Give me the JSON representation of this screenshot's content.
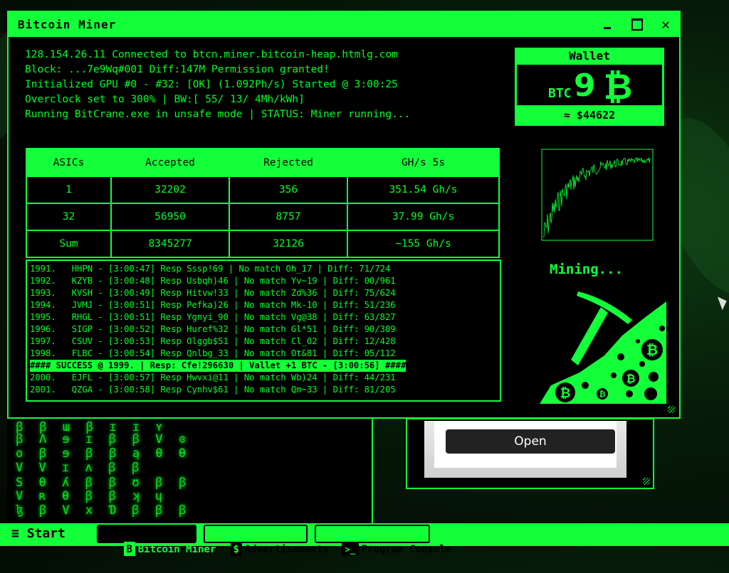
{
  "window": {
    "title": "Bitcoin Miner",
    "close_glyph": "✕"
  },
  "log": [
    "128.154.26.11 Connected to btcn.miner.bitcoin-heap.htmlg.com",
    "Block: ...7e9Wq#001 Diff:147M Permission granted!",
    "Initialized GPU #0 - #32: [OK] (1.092Ph/s) Started @ 3:00:25",
    "Overclock set to 300% | BW:[ 55/ 13/ 4Mh/kWh]",
    "Running BitCrane.exe in unsafe mode | STATUS: Miner running..."
  ],
  "wallet": {
    "title": "Wallet",
    "currency": "BTC",
    "amount": "9",
    "usd": "≈ $44622"
  },
  "stats": {
    "headers": [
      "ASICs",
      "Accepted",
      "Rejected",
      "GH/s 5s"
    ],
    "rows": [
      [
        "1",
        "32202",
        "356",
        "351.54 Gh/s"
      ],
      [
        "32",
        "56950",
        "8757",
        "37.99 Gh/s"
      ],
      [
        "Sum",
        "8345277",
        "32126",
        "~155 Gh/s"
      ]
    ]
  },
  "mining_log": [
    "1991.   HHPN - [3:00:47] Resp Sssp!69 | No match Oh_17 | Diff: 71/724",
    "1992.   KZYB - [3:00:48] Resp Usbqh)46 | No match Yv~19 | Diff: 00/961",
    "1993.   KVSH - [3:00:49] Resp Hitvw!33 | No match Zd%36 | Diff: 75/624",
    "1994.   JVMJ - [3:00:51] Resp Pefka)26 | No match Mk-10 | Diff: 51/236",
    "1995.   RHGL - [3:00:51] Resp Ygnyi_90 | No match Vg@38 | Diff: 63/827",
    "1996.   SIGP - [3:00:52] Resp Huref%32 | No match Gl*51 | Diff: 90/309",
    "1997.   CSUV - [3:00:53] Resp Olggb$51 | No match Cl_02 | Diff: 12/428",
    "1998.   FLBC - [3:00:54] Resp Qnlbg_33 | No match Ot&81 | Diff: 05/112",
    "#### SUCCESS @ 1999. | Resp: Cfe!296630 | Vallet +1 BTC - [3:00:56] ####",
    "2000.   EJFL - [3:00:57] Resp Hwvxi@11 | No match Wb)24 | Diff: 44/231",
    "2001.   QZGA - [3:00:58] Resp Cynhv$61 | No match Qm~33 | Diff: 81/205"
  ],
  "mining_status": "Mining...",
  "ad": {
    "open_label": "Open"
  },
  "matrix": [
    "ꞵ ꞵ ɯ ꞵ ɪ ɪ ʏ",
    "ꞵ Λ ɘ ɪ ꞵ ꞵ V ɞ",
    "o ꞵ ɘ ꞵ ꞵ ą θ θ",
    "V V ɪ ʌ ꞵ ꞵ",
    "S θ ʎ ꞵ ꞵ ʊ ꞵ ꞵ",
    "V ʀ θ ꞵ ꞵ ʞ ɥ",
    "ɮ ꞵ V x Ɗ ꞵ ꞵ ꞵ"
  ],
  "taskbar": {
    "start_glyph": "≡",
    "start_label": "Start",
    "items": [
      {
        "icon": "B",
        "label": "Bitcoin Miner"
      },
      {
        "icon": "$",
        "label": "Advertisements"
      },
      {
        "icon": ">_",
        "label": "Program Console"
      }
    ]
  },
  "colors": {
    "accent": "#12ff3a",
    "text": "#00ff22",
    "bg": "#000000"
  }
}
